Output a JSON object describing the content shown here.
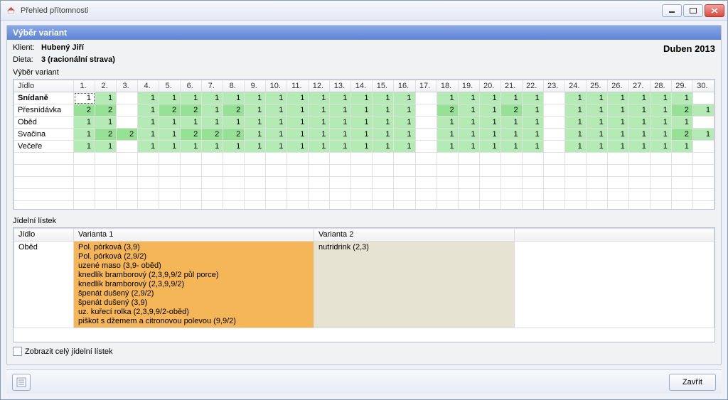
{
  "window": {
    "title": "Přehled přítomnosti",
    "min_icon": "—",
    "max_icon": "▢",
    "close_icon": "✕"
  },
  "panel": {
    "header": "Výběr variant",
    "klient_label": "Klient:",
    "klient_value": "Hubený Jiří",
    "dieta_label": "Dieta:",
    "dieta_value": "3 (racionální strava)",
    "date": "Duben 2013",
    "section1": "Výběr variant",
    "section2": "Jídelní lístek",
    "checkbox_label": "Zobrazit celý jídelní lístek"
  },
  "grid": {
    "col0": "Jídlo",
    "days": [
      "1.",
      "2.",
      "3.",
      "4.",
      "5.",
      "6.",
      "7.",
      "8.",
      "9.",
      "10.",
      "11.",
      "12.",
      "13.",
      "14.",
      "15.",
      "16.",
      "17.",
      "18.",
      "19.",
      "20.",
      "21.",
      "22.",
      "23.",
      "24.",
      "25.",
      "26.",
      "27.",
      "28.",
      "29.",
      "30."
    ],
    "rows": [
      {
        "meal": "Snídaně",
        "selected": true,
        "values": [
          1,
          1,
          null,
          1,
          1,
          1,
          1,
          1,
          1,
          1,
          1,
          1,
          1,
          1,
          1,
          1,
          null,
          1,
          1,
          1,
          1,
          1,
          null,
          1,
          1,
          1,
          1,
          1,
          1,
          null
        ],
        "selected_col": 0
      },
      {
        "meal": "Přesnídávka",
        "values": [
          2,
          2,
          null,
          1,
          2,
          2,
          1,
          2,
          1,
          1,
          1,
          1,
          1,
          1,
          1,
          1,
          null,
          2,
          1,
          1,
          2,
          1,
          null,
          1,
          1,
          1,
          1,
          1,
          2,
          1
        ]
      },
      {
        "meal": "Oběd",
        "values": [
          1,
          1,
          null,
          1,
          1,
          1,
          1,
          1,
          1,
          1,
          1,
          1,
          1,
          1,
          1,
          1,
          null,
          1,
          1,
          1,
          1,
          1,
          null,
          1,
          1,
          1,
          1,
          1,
          1,
          null
        ]
      },
      {
        "meal": "Svačina",
        "values": [
          1,
          2,
          2,
          1,
          1,
          2,
          2,
          2,
          1,
          1,
          1,
          1,
          1,
          1,
          1,
          1,
          null,
          1,
          1,
          1,
          1,
          1,
          null,
          1,
          1,
          1,
          1,
          1,
          2,
          1
        ]
      },
      {
        "meal": "Večeře",
        "values": [
          1,
          1,
          null,
          1,
          1,
          1,
          1,
          1,
          1,
          1,
          1,
          1,
          1,
          1,
          1,
          1,
          null,
          1,
          1,
          1,
          1,
          1,
          null,
          1,
          1,
          1,
          1,
          1,
          1,
          null
        ]
      }
    ]
  },
  "menu": {
    "col0": "Jídlo",
    "col1": "Varianta 1",
    "col2": "Varianta 2",
    "row_meal": "Oběd",
    "variant1_items": [
      "Pol. pórková (3,9)",
      "Pol. pórková (2,9/2)",
      "uzené maso (3,9- oběd)",
      "knedlík bramborový (2,3,9,9/2 půl porce)",
      "knedlík bramborový (2,3,9,9/2)",
      "špenát dušený (2,9/2)",
      "špenát dušený (3,9)",
      "uz. kuřecí rolka (2,3,9,9/2-oběd)",
      "piškot s džemem a citronovou polevou (9,9/2)"
    ],
    "variant2_items": [
      "nutridrink (2,3)"
    ]
  },
  "footer": {
    "close_label": "Zavřít"
  }
}
